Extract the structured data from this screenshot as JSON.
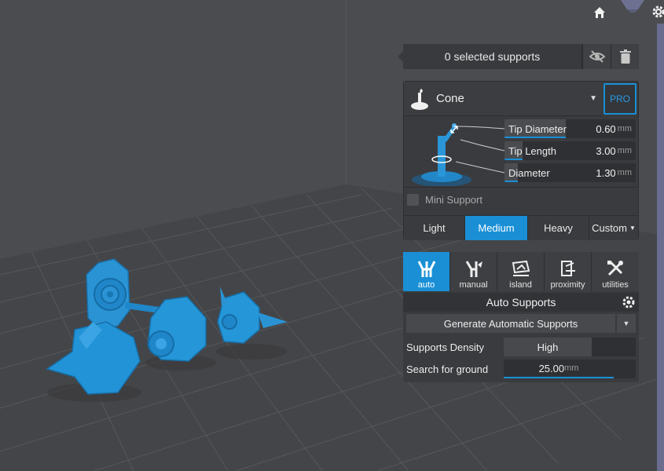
{
  "selection": {
    "text": "0 selected supports"
  },
  "support_type": {
    "label": "Cone",
    "pro": "PRO"
  },
  "params": [
    {
      "name": "Tip Diameter",
      "value": "0.60",
      "unit": "mm",
      "fill": 0.47
    },
    {
      "name": "Tip Length",
      "value": "3.00",
      "unit": "mm",
      "fill": 0.14
    },
    {
      "name": "Diameter",
      "value": "1.30",
      "unit": "mm",
      "fill": 0.1
    }
  ],
  "mini_support": {
    "label": "Mini Support",
    "checked": false
  },
  "density": {
    "options": [
      "Light",
      "Medium",
      "Heavy",
      "Custom"
    ],
    "active": "Medium"
  },
  "tabs": [
    {
      "label": "auto",
      "icon": "auto-supports-icon",
      "active": true
    },
    {
      "label": "manual",
      "icon": "manual-supports-icon",
      "active": false
    },
    {
      "label": "island",
      "icon": "island-icon",
      "active": false
    },
    {
      "label": "proximity",
      "icon": "proximity-icon",
      "active": false
    },
    {
      "label": "utilities",
      "icon": "utilities-icon",
      "active": false
    }
  ],
  "auto": {
    "title": "Auto Supports",
    "generate": "Generate Automatic Supports",
    "density_label": "Supports Density",
    "density_value": "High",
    "ground_label": "Search for ground",
    "ground_value": "25.00",
    "ground_unit": "mm"
  },
  "colors": {
    "accent": "#1a8fd6",
    "model": "#1f8fd0",
    "panel": "#3a3b3e"
  }
}
